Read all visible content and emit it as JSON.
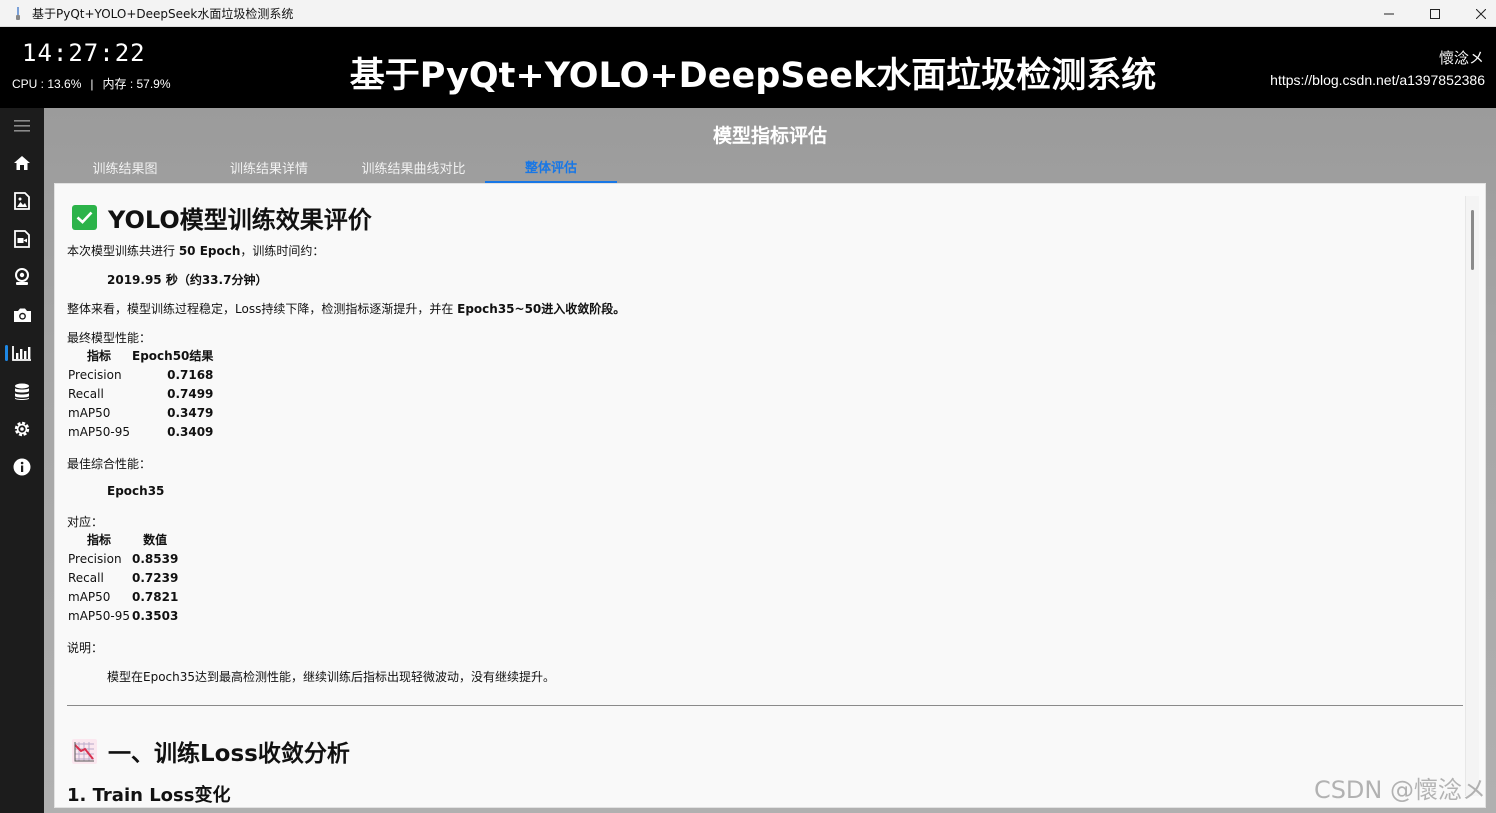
{
  "window": {
    "title": "基于PyQt+YOLO+DeepSeek水面垃圾检测系统",
    "controls": {
      "minimize": "—",
      "maximize": "☐",
      "close": "✕"
    }
  },
  "header": {
    "clock": "14:27:22",
    "cpu": "CPU : 13.6%",
    "separator": "|",
    "memory": "内存 : 57.9%",
    "title": "基于PyQt+YOLO+DeepSeek水面垃圾检测系统",
    "author": "懷淰メ",
    "blog": "https://blog.csdn.net/a1397852386"
  },
  "sidebar": {
    "items": [
      {
        "icon": "menu-icon"
      },
      {
        "icon": "home-icon"
      },
      {
        "icon": "image-icon"
      },
      {
        "icon": "video-icon"
      },
      {
        "icon": "webcam-icon"
      },
      {
        "icon": "camera-icon"
      },
      {
        "icon": "bar-chart-icon",
        "active": true
      },
      {
        "icon": "database-icon"
      },
      {
        "icon": "settings-icon"
      },
      {
        "icon": "info-icon"
      }
    ]
  },
  "page": {
    "title": "模型指标评估",
    "tabs": [
      "训练结果图",
      "训练结果详情",
      "训练结果曲线对比",
      "整体评估"
    ],
    "active_tab": 3
  },
  "report": {
    "heading": "YOLO模型训练效果评价",
    "intro_prefix": "本次模型训练共进行 ",
    "intro_epochs": "50 Epoch",
    "intro_suffix": "，训练时间约：",
    "duration": "2019.95 秒（约33.7分钟）",
    "summary_prefix": "整体来看，模型训练过程稳定，Loss持续下降，检测指标逐渐提升，并在 ",
    "summary_bold": "Epoch35~50进入收敛阶段。",
    "final_label": "最终模型性能：",
    "final_table": {
      "headers": [
        "指标",
        "Epoch50结果"
      ],
      "rows": [
        [
          "Precision",
          "0.7168"
        ],
        [
          "Recall",
          "0.7499"
        ],
        [
          "mAP50",
          "0.3479"
        ],
        [
          "mAP50-95",
          "0.3409"
        ]
      ]
    },
    "best_label": "最佳综合性能：",
    "best_epoch": "Epoch35",
    "corresponding_label": "对应：",
    "best_table": {
      "headers": [
        "指标",
        "数值"
      ],
      "rows": [
        [
          "Precision",
          "0.8539"
        ],
        [
          "Recall",
          "0.7239"
        ],
        [
          "mAP50",
          "0.7821"
        ],
        [
          "mAP50-95",
          "0.3503"
        ]
      ]
    },
    "note_label": "说明：",
    "note_text": "模型在Epoch35达到最高检测性能，继续训练后指标出现轻微波动，没有继续提升。",
    "section1_heading": "一、训练Loss收敛分析",
    "section1_sub": "1. Train Loss变化"
  },
  "watermark": "CSDN @懷淰メ",
  "colors": {
    "accent": "#1877e6",
    "check_green": "#2cb34a",
    "header_bg": "#000000",
    "sidebar_bg": "#1c1c1c"
  }
}
